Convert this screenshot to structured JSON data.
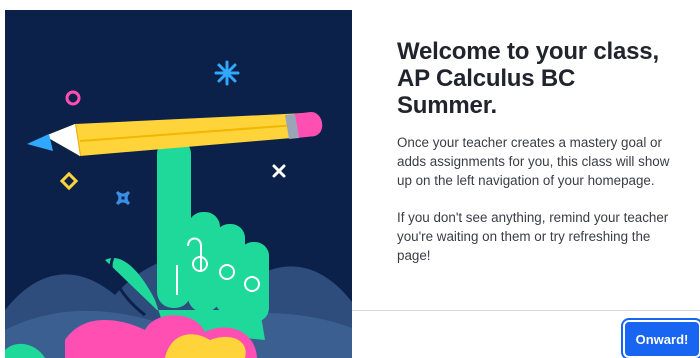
{
  "dialog": {
    "title": "Welcome to your class, AP Calculus BC Summer.",
    "paragraphs": [
      "Once your teacher creates a mastery goal or adds assignments for you, this class will show up on the left navigation of your homepage.",
      "If you don't see anything, remind your teacher you're waiting on them or try refreshing the page!"
    ],
    "button_label": "Onward!"
  },
  "illustration": {
    "icons": [
      "pencil-icon",
      "pointing-hand-icon",
      "sparkle-icon",
      "star-icon",
      "ring-icon",
      "diamond-icon",
      "x-icon",
      "blob-icon"
    ]
  },
  "colors": {
    "navy": "#0b2149",
    "accent": "#1865f2",
    "green": "#1fd99a",
    "pink": "#ff4fb2",
    "yellow": "#ffd33a",
    "blue": "#3a8ee6"
  }
}
